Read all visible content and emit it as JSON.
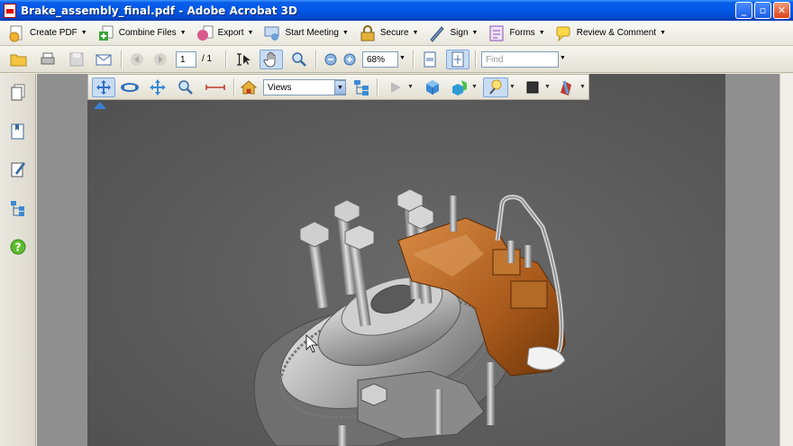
{
  "window": {
    "title": "Brake_assembly_final.pdf - Adobe Acrobat 3D",
    "minimize": "_",
    "maximize": "▫",
    "close": "✕"
  },
  "tasks_toolbar": [
    {
      "label": "Create PDF",
      "icon": "create-pdf-icon"
    },
    {
      "label": "Combine Files",
      "icon": "combine-files-icon"
    },
    {
      "label": "Export",
      "icon": "export-icon"
    },
    {
      "label": "Start Meeting",
      "icon": "meeting-icon"
    },
    {
      "label": "Secure",
      "icon": "lock-icon"
    },
    {
      "label": "Sign",
      "icon": "pen-icon"
    },
    {
      "label": "Forms",
      "icon": "forms-icon"
    },
    {
      "label": "Review & Comment",
      "icon": "comment-icon"
    }
  ],
  "nav_toolbar": {
    "page_current": "1",
    "page_total": "/ 1",
    "zoom": "68%",
    "find_placeholder": "Find"
  },
  "three_d_toolbar": {
    "views_value": "Views"
  },
  "colors": {
    "accent": "#3b7fd6",
    "viewport_bg": "#5a5a5a",
    "caliper": "#b4651f"
  }
}
